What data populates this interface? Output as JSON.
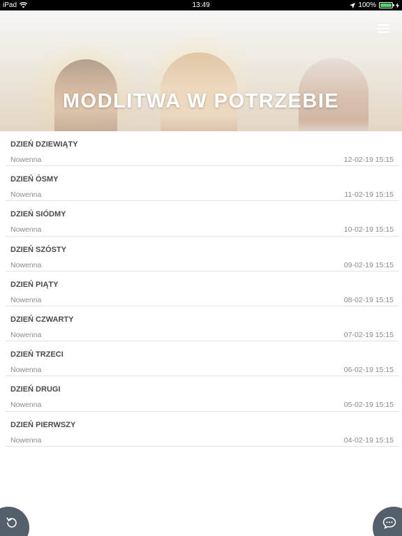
{
  "status_bar": {
    "device": "iPad",
    "time": "13:49",
    "battery": "100%"
  },
  "header": {
    "title": "MODLITWA W POTRZEBIE",
    "menu_icon": "hamburger-menu-icon"
  },
  "items": [
    {
      "title": "DZIEŃ DZIEWIĄTY",
      "category": "Nowenna",
      "date": "12-02-19 15:15"
    },
    {
      "title": "DZIEŃ ÓSMY",
      "category": "Nowenna",
      "date": "11-02-19 15:15"
    },
    {
      "title": "DZIEŃ SIÓDMY",
      "category": "Nowenna",
      "date": "10-02-19 15:15"
    },
    {
      "title": "DZIEŃ SZÓSTY",
      "category": "Nowenna",
      "date": "09-02-19 15:15"
    },
    {
      "title": "DZIEŃ PIĄTY",
      "category": "Nowenna",
      "date": "08-02-19 15:15"
    },
    {
      "title": "DZIEŃ CZWARTY",
      "category": "Nowenna",
      "date": "07-02-19 15:15"
    },
    {
      "title": "DZIEŃ TRZECI",
      "category": "Nowenna",
      "date": "06-02-19 15:15"
    },
    {
      "title": "DZIEŃ DRUGI",
      "category": "Nowenna",
      "date": "05-02-19 15:15"
    },
    {
      "title": "DZIEŃ PIERWSZY",
      "category": "Nowenna",
      "date": "04-02-19 15:15"
    }
  ],
  "fab": {
    "left_icon": "refresh-icon",
    "right_icon": "chat-bubble-icon",
    "color": "#53606b"
  },
  "colors": {
    "status_bar": "#000000",
    "battery": "#4cd964",
    "title_text": "#ffffff",
    "item_title": "#4a4a4a",
    "item_meta": "#8a8a8a"
  }
}
